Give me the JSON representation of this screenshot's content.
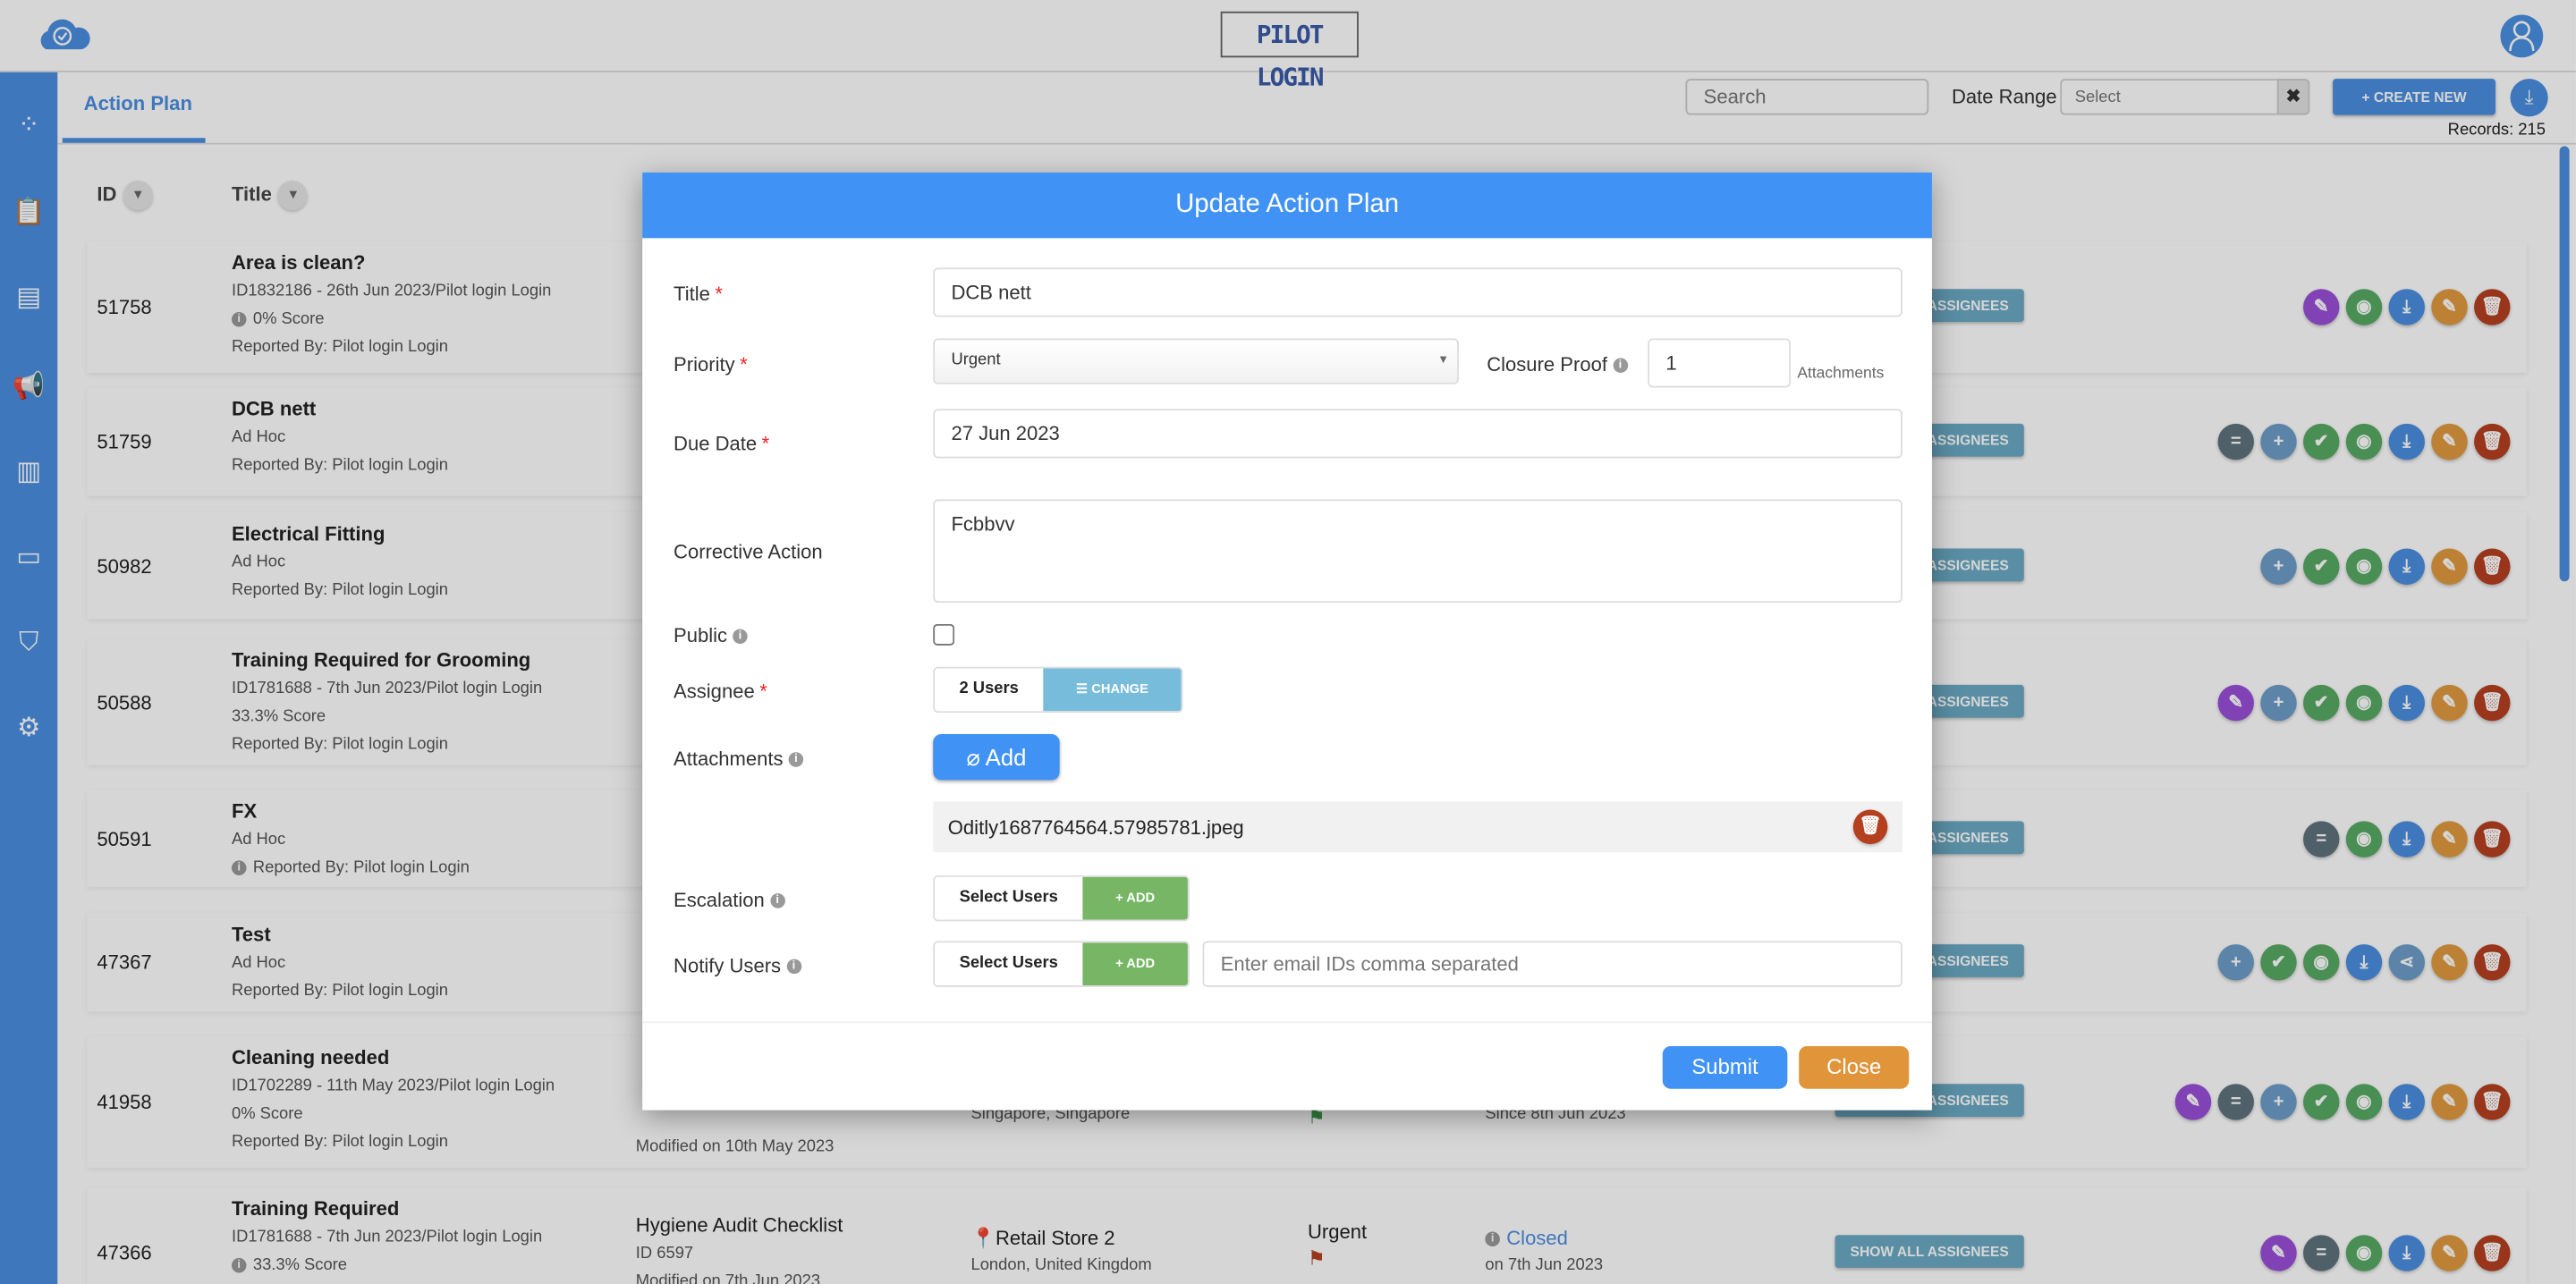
{
  "header": {
    "brand": "PILOT LOGIN"
  },
  "sidebar": {
    "items": [
      {
        "icon": "dashboard-icon"
      },
      {
        "icon": "clipboard-icon"
      },
      {
        "icon": "document-icon"
      },
      {
        "icon": "megaphone-icon"
      },
      {
        "icon": "analytics-icon"
      },
      {
        "icon": "training-icon"
      },
      {
        "icon": "shield-icon"
      },
      {
        "icon": "gear-icon"
      }
    ]
  },
  "tabs": [
    {
      "label": "Action Plan",
      "active": true
    }
  ],
  "toolbar": {
    "search_placeholder": "Search",
    "date_range_label": "Date Range",
    "date_range_placeholder": "Select",
    "clear": "✖",
    "create_new": "+ CREATE NEW",
    "records": "Records: 215"
  },
  "columns": [
    "ID",
    "Title"
  ],
  "rows": [
    {
      "id": "51758",
      "title": "Area is clean?",
      "lines": [
        "ID1832186 - 26th Jun 2023/Pilot login Login",
        "0% Score",
        "Reported By: Pilot login Login"
      ],
      "info_line": 1,
      "actions": [
        "edit",
        "view",
        "download",
        "pencil",
        "delete"
      ]
    },
    {
      "id": "51759",
      "title": "DCB nett",
      "lines": [
        "Ad Hoc",
        "Reported By: Pilot login Login"
      ],
      "info_line": -1,
      "actions": [
        "equals",
        "plus",
        "check",
        "view",
        "download",
        "pencil",
        "delete"
      ]
    },
    {
      "id": "50982",
      "title": "Electrical Fitting",
      "lines": [
        "Ad Hoc",
        "Reported By: Pilot login Login"
      ],
      "info_line": -1,
      "actions": [
        "plus",
        "check",
        "view",
        "download",
        "pencil",
        "delete"
      ]
    },
    {
      "id": "50588",
      "title": "Training Required for Grooming",
      "lines": [
        "ID1781688 - 7th Jun 2023/Pilot login Login",
        "33.3% Score",
        "Reported By: Pilot login Login"
      ],
      "info_line": -1,
      "actions": [
        "edit",
        "plus",
        "check",
        "view",
        "download",
        "pencil",
        "delete"
      ]
    },
    {
      "id": "50591",
      "title": "FX",
      "lines": [
        "Ad Hoc",
        "Reported By: Pilot login Login"
      ],
      "info_line": 1,
      "actions": [
        "equals",
        "view",
        "download",
        "pencil",
        "delete"
      ]
    },
    {
      "id": "47367",
      "title": "Test",
      "lines": [
        "Ad Hoc",
        "Reported By: Pilot login Login"
      ],
      "info_line": -1,
      "actions": [
        "plus",
        "check",
        "view",
        "download",
        "share",
        "pencil",
        "delete"
      ]
    },
    {
      "id": "41958",
      "title": "Cleaning needed",
      "lines": [
        "ID1702289 - 11th May 2023/Pilot login Login",
        "0% Score",
        "Reported By: Pilot login Login"
      ],
      "info_line": -1,
      "checklist": {
        "modified": "Modified on 10th May 2023"
      },
      "location": {
        "sub": "Singapore, Singapore"
      },
      "priority_flag": "#3c9a4a",
      "status": {
        "date": "Since 8th Jun 2023"
      },
      "actions": [
        "edit",
        "equals",
        "plus",
        "check",
        "view",
        "download",
        "pencil",
        "delete"
      ]
    },
    {
      "id": "47366",
      "title": "Training Required",
      "lines": [
        "ID1781688 - 7th Jun 2023/Pilot login Login",
        "33.3% Score",
        "Reported By: Pilot login Login"
      ],
      "info_line": 1,
      "checklist": {
        "name": "Hygiene Audit Checklist",
        "id": "ID 6597",
        "modified": "Modified on 7th Jun 2023"
      },
      "location": {
        "name": "Retail Store 2",
        "sub": "London, United Kingdom"
      },
      "priority": "Urgent",
      "priority_flag": "#b5401f",
      "status": {
        "label": "Closed",
        "date": "on 7th Jun 2023"
      },
      "actions": [
        "edit",
        "equals",
        "view",
        "download",
        "pencil",
        "delete"
      ]
    }
  ],
  "assignees_label": "SHOW ALL ASSIGNEES",
  "modal": {
    "title": "Update Action Plan",
    "fields": {
      "title_label": "Title",
      "title_value": "DCB nett",
      "priority_label": "Priority",
      "priority_value": "Urgent",
      "closure_label": "Closure Proof",
      "closure_value": "1",
      "closure_unit": "Attachments",
      "due_label": "Due Date",
      "due_value": "27 Jun 2023",
      "corrective_label": "Corrective Action",
      "corrective_value": "Fcbbvv",
      "public_label": "Public",
      "public_checked": false,
      "assignee_label": "Assignee",
      "assignee_value": "2 Users",
      "assignee_change": "CHANGE",
      "attachments_label": "Attachments",
      "attachments_add": "Add",
      "attachment_file": "Oditly1687764564.57985781.jpeg",
      "escalation_label": "Escalation",
      "escalation_select": "Select Users",
      "escalation_add": "+ ADD",
      "notify_label": "Notify Users",
      "notify_select": "Select Users",
      "notify_add": "+ ADD",
      "notify_placeholder": "Enter email IDs comma separated"
    },
    "submit": "Submit",
    "close": "Close"
  },
  "colors": {
    "accent": "#4a8ee0",
    "modal_header": "#4192f5",
    "add_green": "#76b665",
    "change_blue": "#78bcdb",
    "close_orange": "#e0953b",
    "delete_red": "#b5401f"
  }
}
